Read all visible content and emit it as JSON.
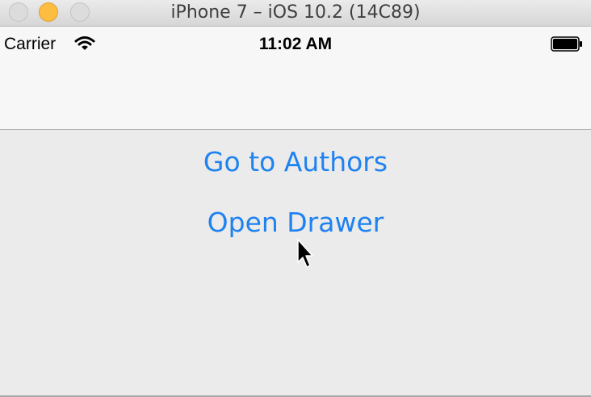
{
  "window": {
    "title": "iPhone 7 – iOS 10.2 (14C89)"
  },
  "statusbar": {
    "carrier": "Carrier",
    "time": "11:02 AM",
    "wifi_icon": "wifi-icon",
    "battery_icon": "battery-icon"
  },
  "main": {
    "go_to_authors_label": "Go to Authors",
    "open_drawer_label": "Open Drawer"
  },
  "colors": {
    "ios_link_blue": "#1e82f0",
    "traffic_minimize": "#fdbd41"
  }
}
